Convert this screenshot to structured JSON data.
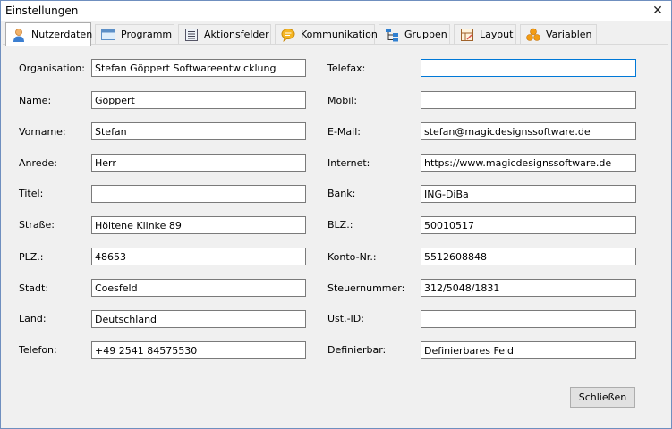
{
  "window": {
    "title": "Einstellungen",
    "close_glyph": "✕"
  },
  "tabs": [
    {
      "label": "Nutzerdaten",
      "icon": "user-icon",
      "active": true
    },
    {
      "label": "Programm",
      "icon": "window-icon"
    },
    {
      "label": "Aktionsfelder",
      "icon": "list-icon"
    },
    {
      "label": "Kommunikation",
      "icon": "speech-bubble-icon"
    },
    {
      "label": "Gruppen",
      "icon": "hierarchy-icon"
    },
    {
      "label": "Layout",
      "icon": "layout-icon"
    },
    {
      "label": "Variablen",
      "icon": "variables-icon"
    }
  ],
  "left_fields": [
    {
      "label": "Organisation:",
      "value": "Stefan Göppert Softwareentwicklung"
    },
    {
      "label": "Name:",
      "value": "Göppert"
    },
    {
      "label": "Vorname:",
      "value": "Stefan"
    },
    {
      "label": "Anrede:",
      "value": "Herr"
    },
    {
      "label": "Titel:",
      "value": ""
    },
    {
      "label": "Straße:",
      "value": "Höltene Klinke 89"
    },
    {
      "label": "PLZ.:",
      "value": "48653"
    },
    {
      "label": "Stadt:",
      "value": "Coesfeld"
    },
    {
      "label": "Land:",
      "value": "Deutschland"
    },
    {
      "label": "Telefon:",
      "value": "+49 2541 84575530"
    }
  ],
  "right_fields": [
    {
      "label": "Telefax:",
      "value": ""
    },
    {
      "label": "Mobil:",
      "value": ""
    },
    {
      "label": "E-Mail:",
      "value": "stefan@magicdesignssoftware.de"
    },
    {
      "label": "Internet:",
      "value": "https://www.magicdesignssoftware.de"
    },
    {
      "label": "Bank:",
      "value": "ING-DiBa"
    },
    {
      "label": "BLZ.:",
      "value": "50010517"
    },
    {
      "label": "Konto-Nr.:",
      "value": "5512608848"
    },
    {
      "label": "Steuernummer:",
      "value": "312/5048/1831"
    },
    {
      "label": "Ust.-ID:",
      "value": ""
    },
    {
      "label": "Definierbar:",
      "value": "Definierbares Feld"
    }
  ],
  "close_button": {
    "label": "Schließen"
  },
  "colors": {
    "focus_border": "#0078d7",
    "window_border": "#6f8fbf",
    "dialog_bg": "#f0f0f0"
  }
}
